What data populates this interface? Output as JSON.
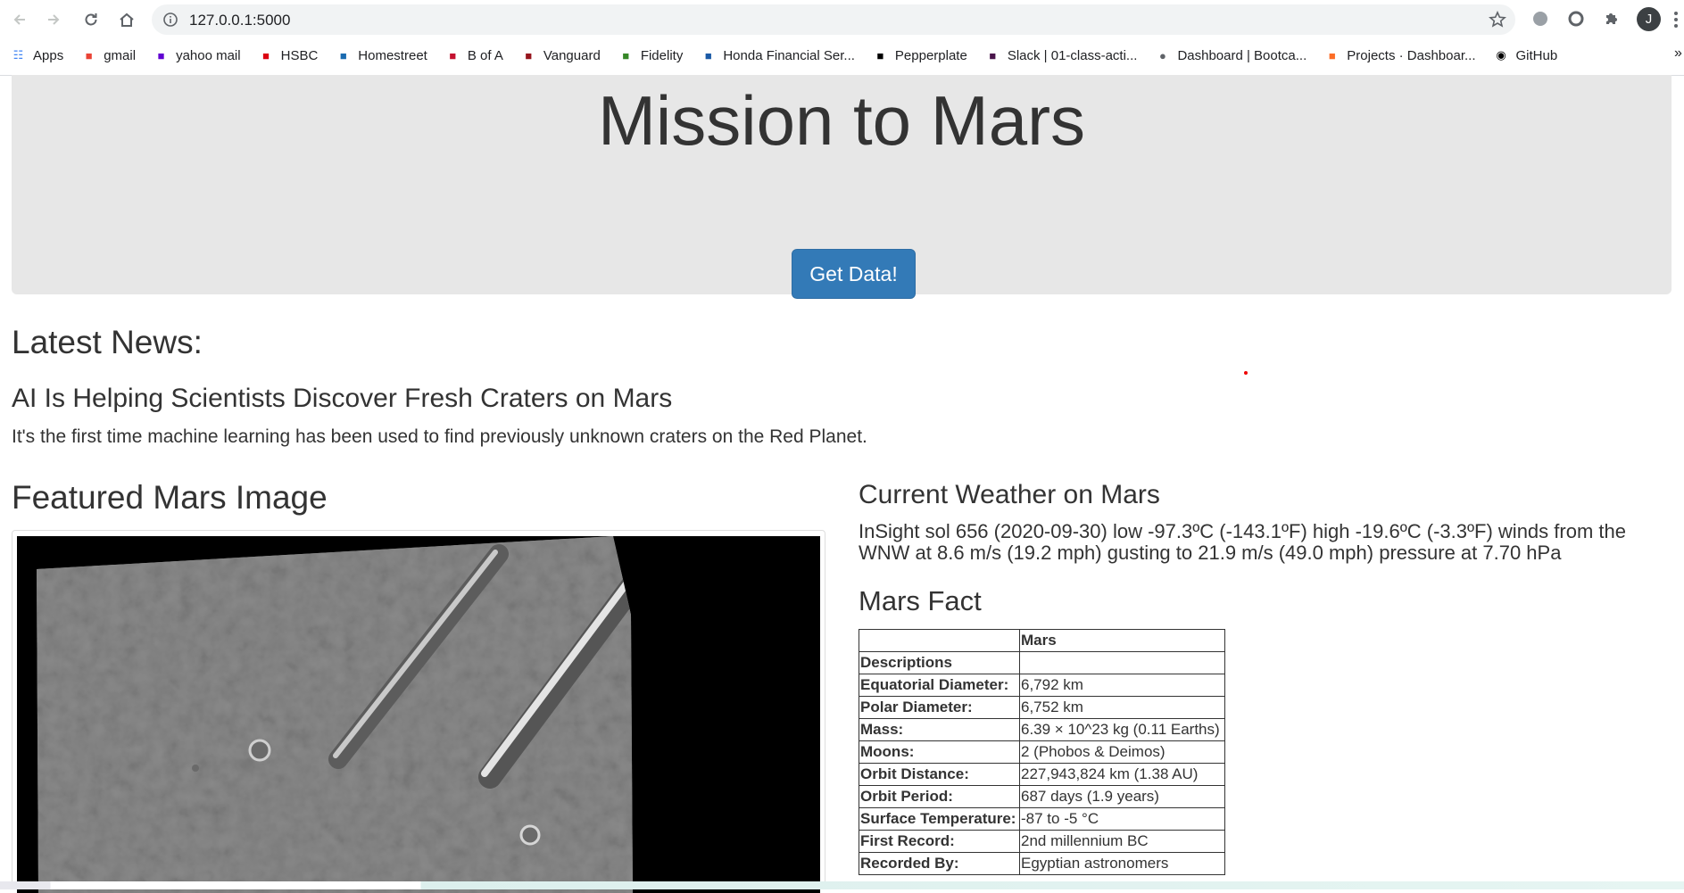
{
  "browser": {
    "url": "127.0.0.1:5000",
    "avatar_letter": "J",
    "bookmarks": [
      {
        "label": "Apps",
        "icon": "apps-grid-icon",
        "color": "#4285f4"
      },
      {
        "label": "gmail",
        "icon": "gmail-icon",
        "color": "#ea4335"
      },
      {
        "label": "yahoo mail",
        "icon": "yahoo-mail-icon",
        "color": "#6001d2"
      },
      {
        "label": "HSBC",
        "icon": "hsbc-icon",
        "color": "#db0011"
      },
      {
        "label": "Homestreet",
        "icon": "homestreet-icon",
        "color": "#1a6bb0"
      },
      {
        "label": "B of A",
        "icon": "bofa-icon",
        "color": "#c41230"
      },
      {
        "label": "Vanguard",
        "icon": "vanguard-icon",
        "color": "#96151d"
      },
      {
        "label": "Fidelity",
        "icon": "fidelity-icon",
        "color": "#368727"
      },
      {
        "label": "Honda Financial Ser...",
        "icon": "honda-icon",
        "color": "#1b5aa6"
      },
      {
        "label": "Pepperplate",
        "icon": "pepperplate-icon",
        "color": "#000000"
      },
      {
        "label": "Slack | 01-class-acti...",
        "icon": "slack-icon",
        "color": "#4a154b"
      },
      {
        "label": "Dashboard | Bootca...",
        "icon": "globe-icon",
        "color": "#5f6368"
      },
      {
        "label": "Projects · Dashboar...",
        "icon": "gitlab-icon",
        "color": "#fc6d26"
      },
      {
        "label": "GitHub",
        "icon": "github-icon",
        "color": "#000000"
      }
    ],
    "more_bookmarks": "»"
  },
  "jumbotron": {
    "title": "Mission to Mars",
    "button_label": "Get Data!",
    "button_color": "#337ab7"
  },
  "news": {
    "heading": "Latest News:",
    "title": "AI Is Helping Scientists Discover Fresh Craters on Mars",
    "paragraph": "It's the first time machine learning has been used to find previously unknown craters on the Red Planet."
  },
  "featured_image": {
    "heading": "Featured Mars Image"
  },
  "weather": {
    "heading": "Current Weather on Mars",
    "text": "InSight sol 656 (2020-09-30) low -97.3ºC (-143.1ºF) high -19.6ºC (-3.3ºF) winds from the WNW at 8.6 m/s (19.2 mph) gusting to 21.9 m/s (49.0 mph) pressure at 7.70 hPa"
  },
  "facts": {
    "heading": "Mars Fact",
    "header": [
      "",
      "Mars"
    ],
    "index_label": "Descriptions",
    "rows": [
      [
        "Equatorial Diameter:",
        "6,792 km"
      ],
      [
        "Polar Diameter:",
        "6,752 km"
      ],
      [
        "Mass:",
        "6.39 × 10^23 kg (0.11 Earths)"
      ],
      [
        "Moons:",
        "2 (Phobos & Deimos)"
      ],
      [
        "Orbit Distance:",
        "227,943,824 km (1.38 AU)"
      ],
      [
        "Orbit Period:",
        "687 days (1.9 years)"
      ],
      [
        "Surface Temperature:",
        "-87 to -5 °C"
      ],
      [
        "First Record:",
        "2nd millennium BC"
      ],
      [
        "Recorded By:",
        "Egyptian astronomers"
      ]
    ]
  }
}
